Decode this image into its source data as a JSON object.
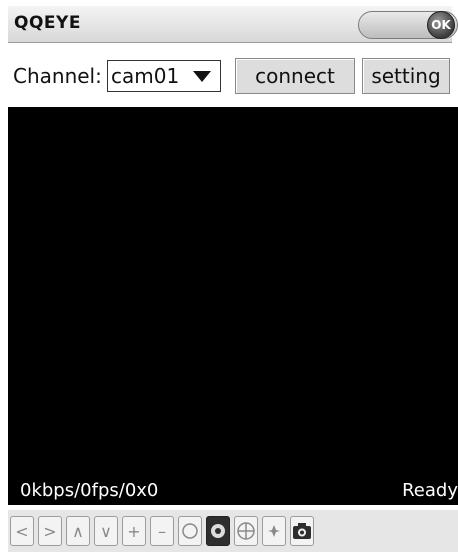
{
  "app": {
    "title": "QQEYE",
    "ok_label": "OK"
  },
  "channel": {
    "label": "Channel:",
    "selected": "cam01"
  },
  "buttons": {
    "connect": "connect",
    "setting": "setting"
  },
  "status": {
    "stats": "0kbps/0fps/0x0",
    "state": "Ready"
  },
  "controls": [
    {
      "name": "pan-left-button",
      "glyph": "<"
    },
    {
      "name": "pan-right-button",
      "glyph": ">"
    },
    {
      "name": "tilt-up-button",
      "glyph": "∧"
    },
    {
      "name": "tilt-down-button",
      "glyph": "∨"
    },
    {
      "name": "zoom-in-button",
      "glyph": "+"
    },
    {
      "name": "zoom-out-button",
      "glyph": "–"
    }
  ]
}
